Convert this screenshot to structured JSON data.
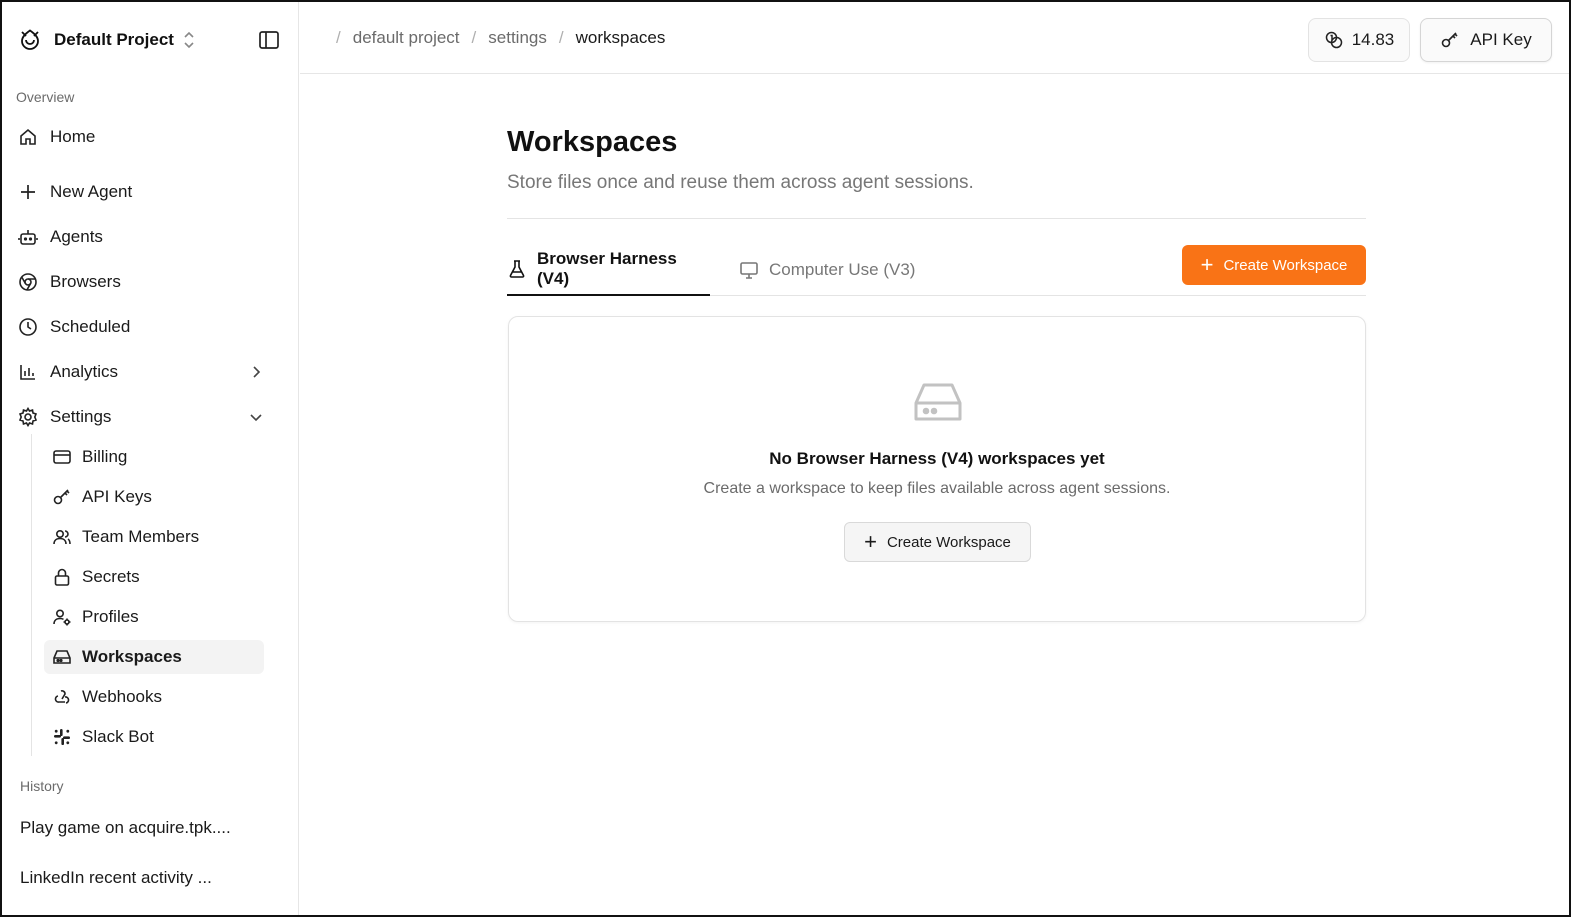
{
  "sidebar": {
    "project_name": "Default Project",
    "overview_label": "Overview",
    "nav": {
      "home": "Home",
      "new_agent": "New Agent",
      "agents": "Agents",
      "browsers": "Browsers",
      "scheduled": "Scheduled",
      "analytics": "Analytics",
      "settings": "Settings"
    },
    "settings_items": {
      "billing": "Billing",
      "api_keys": "API Keys",
      "team_members": "Team Members",
      "secrets": "Secrets",
      "profiles": "Profiles",
      "workspaces": "Workspaces",
      "webhooks": "Webhooks",
      "slack_bot": "Slack Bot"
    },
    "history_label": "History",
    "history": [
      "Play game on acquire.tpk....",
      "LinkedIn recent activity ..."
    ]
  },
  "topbar": {
    "breadcrumb": [
      "default project",
      "settings",
      "workspaces"
    ],
    "credits": "14.83",
    "api_key_label": "API Key"
  },
  "main": {
    "title": "Workspaces",
    "subtitle": "Store files once and reuse them across agent sessions.",
    "tabs": [
      "Browser Harness (V4)",
      "Computer Use (V3)"
    ],
    "create_label": "Create Workspace",
    "empty": {
      "title": "No Browser Harness (V4) workspaces yet",
      "description": "Create a workspace to keep files available across agent sessions.",
      "button_label": "Create Workspace"
    }
  },
  "colors": {
    "accent": "#f97316",
    "active_bg": "#f3f3f3"
  }
}
